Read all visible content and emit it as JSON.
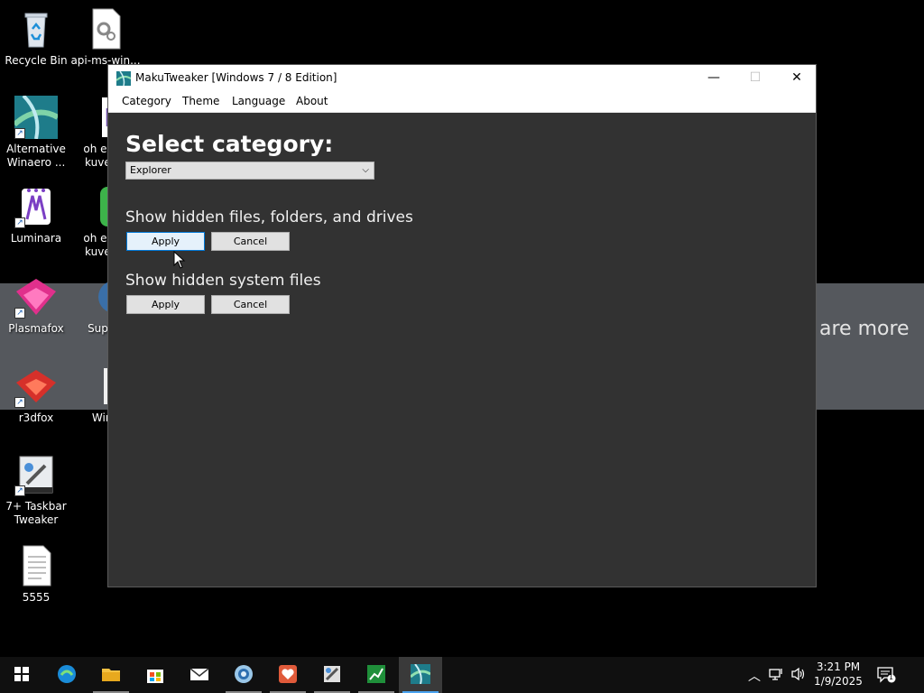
{
  "desktop": {
    "icons": [
      {
        "label": "Recycle Bin"
      },
      {
        "label": "api-ms-win..."
      },
      {
        "label": "Alternative Winaero ..."
      },
      {
        "label": "oh em g kuvertu"
      },
      {
        "label": "Luminara"
      },
      {
        "label": "oh em g kuvertu"
      },
      {
        "label": "Plasmafox"
      },
      {
        "label": "Supert"
      },
      {
        "label": "r3dfox"
      },
      {
        "label": "Wind"
      },
      {
        "label": "7+ Taskbar Tweaker"
      },
      {
        "label": "5555"
      }
    ],
    "banner_text": "are more"
  },
  "window": {
    "title": "MakuTweaker [Windows 7 / 8 Edition]",
    "controls": {
      "minimize": "—",
      "maximize": "☐",
      "close": "✕"
    },
    "menu": [
      "Category",
      "Theme",
      "Language",
      "About"
    ],
    "heading": "Select category:",
    "category_selected": "Explorer",
    "options": [
      {
        "label": "Show hidden files, folders, and drives",
        "apply": "Apply",
        "cancel": "Cancel"
      },
      {
        "label": "Show hidden system files",
        "apply": "Apply",
        "cancel": "Cancel"
      }
    ]
  },
  "taskbar": {
    "items": [
      "start-icon",
      "edge-icon",
      "file-explorer-icon",
      "store-icon",
      "mail-icon",
      "browser-icon",
      "heart-app-icon",
      "tweaker-icon",
      "chart-app-icon",
      "makutweaker-icon"
    ],
    "time": "3:21 PM",
    "date": "1/9/2025",
    "notification_count": "1"
  },
  "colors": {
    "window_bg": "#323232",
    "accent": "#0078d7",
    "taskbar_bg": "#101010"
  }
}
